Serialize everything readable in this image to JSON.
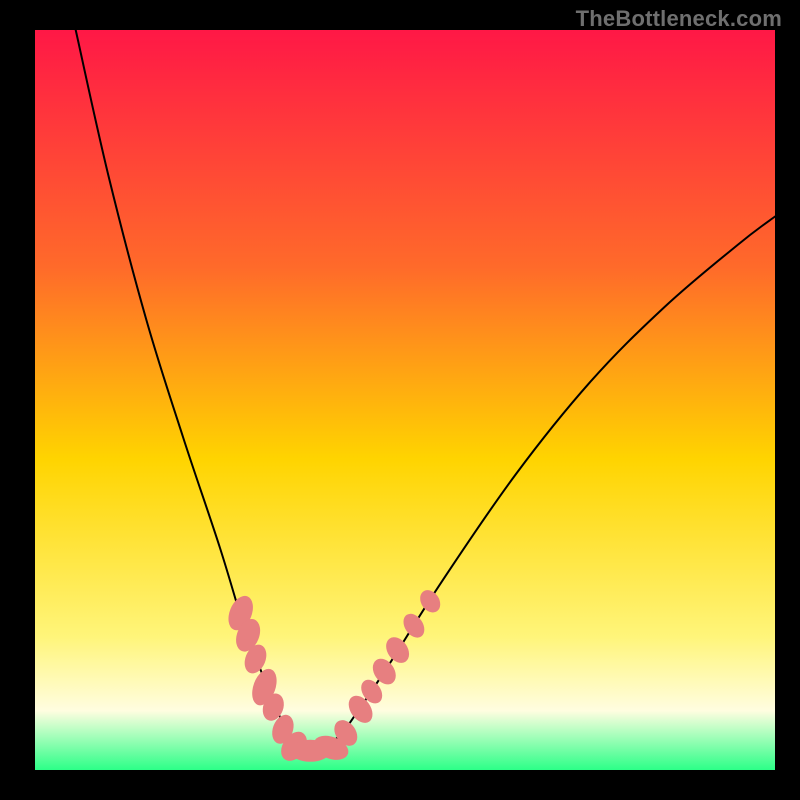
{
  "watermark": "TheBottleneck.com",
  "gradient": {
    "top": "#ff1846",
    "mid1": "#ff6a2a",
    "mid2": "#ffd400",
    "mid3": "#fff57a",
    "band": "#fffde0",
    "bottom": "#2cff88"
  },
  "chart_data": {
    "type": "line",
    "title": "",
    "xlabel": "",
    "ylabel": "",
    "xlim": [
      0,
      1
    ],
    "ylim": [
      0,
      1
    ],
    "curve_comment": "x,y are plot-fraction coords (0,0 = top-left of plot area); the curve is a V with asymmetric arms, minimum around x≈0.36, y≈0.97",
    "series": [
      {
        "name": "curve",
        "x": [
          0.055,
          0.1,
          0.15,
          0.2,
          0.25,
          0.285,
          0.305,
          0.325,
          0.345,
          0.36,
          0.38,
          0.41,
          0.44,
          0.48,
          0.55,
          0.65,
          0.75,
          0.85,
          0.95,
          1.0
        ],
        "y": [
          0.0,
          0.2,
          0.39,
          0.55,
          0.7,
          0.815,
          0.865,
          0.915,
          0.955,
          0.972,
          0.972,
          0.955,
          0.915,
          0.855,
          0.745,
          0.6,
          0.476,
          0.375,
          0.29,
          0.252
        ]
      }
    ],
    "markers_comment": "Pink elongated blobs along the lower arms of the V, plot-fraction coords; sizes in px radius long-axis r1 / short-axis r2",
    "markers": [
      {
        "x": 0.278,
        "y": 0.788,
        "r1": 18,
        "r2": 11,
        "rot": -68
      },
      {
        "x": 0.288,
        "y": 0.818,
        "r1": 17,
        "r2": 11,
        "rot": -68
      },
      {
        "x": 0.298,
        "y": 0.85,
        "r1": 15,
        "r2": 10,
        "rot": -68
      },
      {
        "x": 0.31,
        "y": 0.888,
        "r1": 19,
        "r2": 11,
        "rot": -70
      },
      {
        "x": 0.322,
        "y": 0.915,
        "r1": 14,
        "r2": 10,
        "rot": -70
      },
      {
        "x": 0.335,
        "y": 0.945,
        "r1": 15,
        "r2": 10,
        "rot": -70
      },
      {
        "x": 0.35,
        "y": 0.968,
        "r1": 16,
        "r2": 11,
        "rot": -55
      },
      {
        "x": 0.372,
        "y": 0.974,
        "r1": 20,
        "r2": 11,
        "rot": 0
      },
      {
        "x": 0.4,
        "y": 0.97,
        "r1": 18,
        "r2": 11,
        "rot": 20
      },
      {
        "x": 0.42,
        "y": 0.95,
        "r1": 14,
        "r2": 10,
        "rot": 55
      },
      {
        "x": 0.44,
        "y": 0.918,
        "r1": 15,
        "r2": 10,
        "rot": 55
      },
      {
        "x": 0.455,
        "y": 0.894,
        "r1": 13,
        "r2": 9,
        "rot": 55
      },
      {
        "x": 0.472,
        "y": 0.867,
        "r1": 14,
        "r2": 10,
        "rot": 55
      },
      {
        "x": 0.49,
        "y": 0.838,
        "r1": 14,
        "r2": 10,
        "rot": 55
      },
      {
        "x": 0.512,
        "y": 0.805,
        "r1": 13,
        "r2": 9,
        "rot": 56
      },
      {
        "x": 0.534,
        "y": 0.772,
        "r1": 12,
        "r2": 9,
        "rot": 56
      }
    ],
    "marker_fill": "#e77f80"
  }
}
